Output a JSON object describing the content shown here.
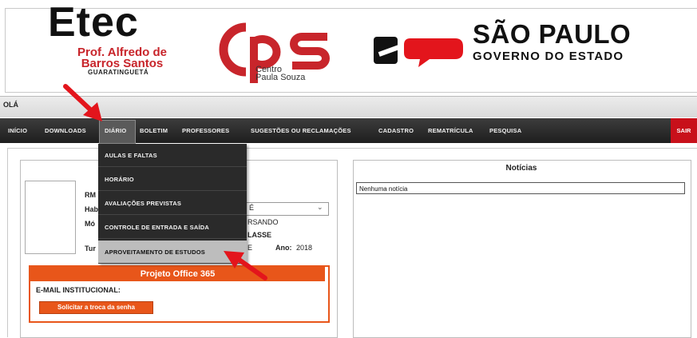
{
  "header": {
    "etec_logo": "Etec",
    "etec_line1": "Prof. Alfredo de",
    "etec_line2": "Barros Santos",
    "etec_city": "GUARATINGUETÁ",
    "cps_logo": "cps",
    "cps_line1": "Centro",
    "cps_line2": "Paula Souza",
    "sp_title": "SÃO PAULO",
    "sp_subtitle": "GOVERNO DO ESTADO"
  },
  "greeting": "OLÁ",
  "nav": {
    "items": [
      "INÍCIO",
      "DOWNLOADS",
      "DIÁRIO",
      "BOLETIM",
      "PROFESSORES",
      "SUGESTÕES OU RECLAMAÇÕES",
      "CADASTRO",
      "REMATRÍCULA",
      "PESQUISA"
    ],
    "exit": "SAIR"
  },
  "dropdown": {
    "items": [
      "AULAS E FALTAS",
      "HORÁRIO",
      "AVALIAÇÕES PREVISTAS",
      "CONTROLE DE ENTRADA E SAÍDA",
      "APROVEITAMENTO DE ESTUDOS"
    ],
    "highlighted": "APROVEITAMENTO DE ESTUDOS"
  },
  "student": {
    "rm_label": "RM",
    "hab_label": "Hab",
    "mod_label": "Mó",
    "tur_label": "Tur",
    "hab_value": "É",
    "status_value": "RSANDO",
    "class_value": "LASSE",
    "tur_value": "E",
    "ano_label": "Ano:",
    "ano_value": "2018"
  },
  "office": {
    "title": "Projeto Office 365",
    "email_label": "E-MAIL INSTITUCIONAL:",
    "button": "Solicitar a troca da senha"
  },
  "news": {
    "title": "Notícias",
    "content": "Nenhuma notícia"
  },
  "colors": {
    "etec_red": "#c8252b",
    "nav_bg": "#2a2a2a",
    "exit_red": "#c8101a",
    "office_orange": "#e8561a",
    "annotation_red": "#e3151c"
  }
}
